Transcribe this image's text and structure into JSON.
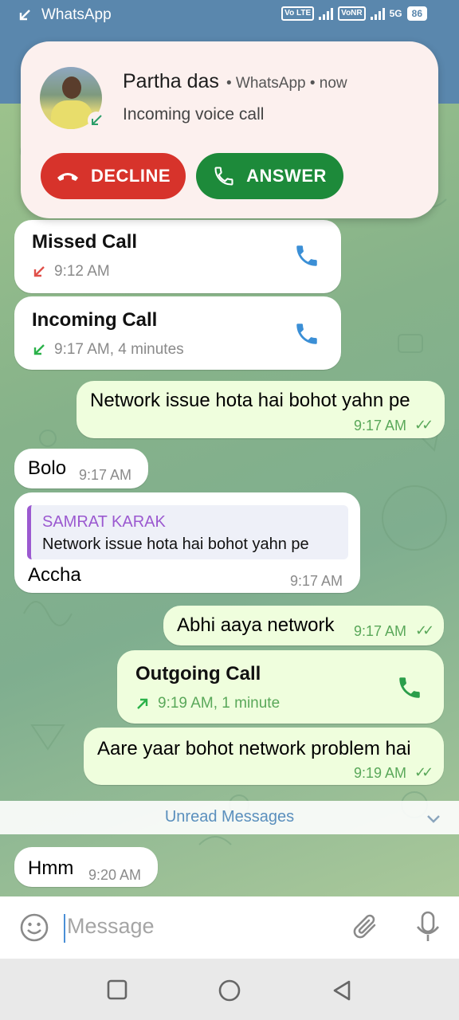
{
  "status_bar": {
    "app_label": "WhatsApp",
    "volte_label": "Vo LTE",
    "vonr_label": "VoNR",
    "net_label": "5G",
    "battery": "86"
  },
  "notification": {
    "caller": "Partha das",
    "meta": "• WhatsApp • now",
    "subtitle": "Incoming voice call",
    "decline_label": "DECLINE",
    "answer_label": "ANSWER"
  },
  "messages": {
    "missed_call": {
      "title": "Missed Call",
      "time": "9:12 AM"
    },
    "incoming_call": {
      "title": "Incoming Call",
      "time": "9:17 AM, 4 minutes"
    },
    "m1": {
      "text": "Network issue hota hai bohot yahn pe",
      "time": "9:17 AM"
    },
    "m2": {
      "text": "Bolo",
      "time": "9:17 AM"
    },
    "m3": {
      "quote_name": "SAMRAT KARAK",
      "quote_text": "Network issue hota hai bohot yahn pe",
      "text": "Accha",
      "time": "9:17 AM"
    },
    "m4": {
      "text": "Abhi aaya network",
      "time": "9:17 AM"
    },
    "outgoing_call": {
      "title": "Outgoing Call",
      "time": "9:19 AM, 1 minute"
    },
    "m5": {
      "text": "Aare yaar bohot network problem hai",
      "time": "9:19 AM"
    },
    "m6": {
      "text": "Hmm",
      "time": "9:20 AM"
    }
  },
  "unread": {
    "label": "Unread Messages"
  },
  "input": {
    "placeholder": "Message"
  },
  "colors": {
    "header": "#5a87ad",
    "decline": "#d7332b",
    "answer": "#1d8a3a",
    "outgoing_bubble": "#effedd",
    "read_ticks": "#5aa85a",
    "missed_arrow": "#e0504a",
    "call_icon": "#3b8fd6"
  },
  "icons": [
    "call-arrow-icon",
    "hangup-icon",
    "phone-icon",
    "emoji-icon",
    "attach-icon",
    "mic-icon",
    "chevron-down-icon",
    "recents-icon",
    "home-icon",
    "back-icon"
  ]
}
